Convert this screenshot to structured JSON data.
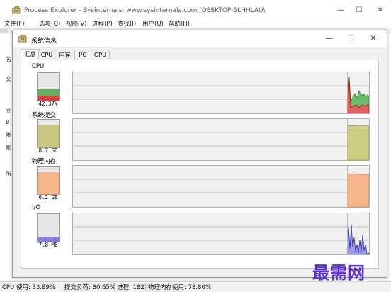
{
  "app": {
    "title": "Process Explorer - Sysinternals: www.sysinternals.com [DESKTOP-5LHHLAU\\",
    "window_buttons": {
      "minimize": "—",
      "maximize": "☐",
      "close": "✕"
    }
  },
  "menu": {
    "items": [
      {
        "label": "文件(F)"
      },
      {
        "label": "选项(O)"
      },
      {
        "label": "视图(V)"
      },
      {
        "label": "进程(P)"
      },
      {
        "label": "查找(I)"
      },
      {
        "label": "用户(U)"
      },
      {
        "label": "帮助(H)"
      }
    ]
  },
  "dialog": {
    "title": "系统信息",
    "buttons": {
      "minimize": "—",
      "maximize": "☐",
      "close": "✕"
    },
    "tabs": [
      {
        "label": "汇总",
        "active": true
      },
      {
        "label": "CPU",
        "active": false
      },
      {
        "label": "内存",
        "active": false
      },
      {
        "label": "I/O",
        "active": false
      },
      {
        "label": "GPU",
        "active": false
      }
    ],
    "sections": [
      {
        "label": "CPU",
        "value": "42.37%",
        "level": 0.42,
        "color": "#5fb05f",
        "secondary_color": "#e04040",
        "secondary_level": 0.17
      },
      {
        "label": "系统提交",
        "value": "8.7 GB",
        "level": 0.81,
        "color": "#c8c880"
      },
      {
        "label": "物理内存",
        "value": "6.2 GB",
        "level": 0.79,
        "color": "#f5b48a"
      },
      {
        "label": "I/O",
        "value": "7.8  MB",
        "level": 0.15,
        "color": "#8080e8"
      }
    ]
  },
  "status": {
    "items": [
      {
        "label": "CPU 使用: 33.89%"
      },
      {
        "label": "提交负荷: 80.65%"
      },
      {
        "label": "进程: 182"
      },
      {
        "label": "物理内存使用: 78.86%"
      }
    ]
  },
  "left_panel": {
    "chars": [
      "名",
      "文",
      "立",
      "B",
      "帐",
      "帐",
      "所"
    ]
  },
  "watermark": "最需网",
  "colors": {
    "titlebar": "#ffffff",
    "dialog_bg": "#f0f0f0",
    "graph_bg": "#f0f0f0",
    "accent": "#5a2fcf"
  }
}
